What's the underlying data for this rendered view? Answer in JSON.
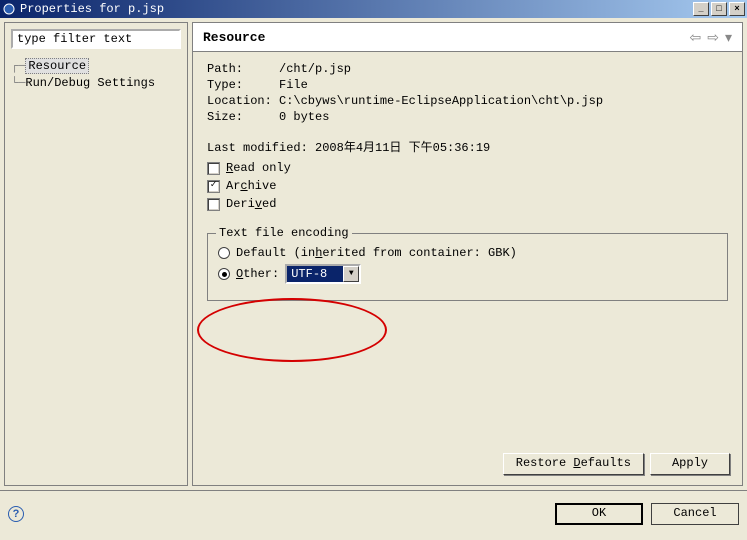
{
  "window": {
    "title": "Properties for p.jsp",
    "minimize": "_",
    "maximize": "□",
    "close": "×"
  },
  "filter": {
    "placeholder": "type filter text"
  },
  "tree": {
    "resource": "Resource",
    "runDebug": "Run/Debug Settings"
  },
  "header": {
    "title": "Resource"
  },
  "info": {
    "pathKey": "Path:",
    "pathVal": "/cht/p.jsp",
    "typeKey": "Type:",
    "typeVal": "File",
    "locKey": "Location:",
    "locVal": "C:\\cbyws\\runtime-EclipseApplication\\cht\\p.jsp",
    "sizeKey": "Size:",
    "sizeVal": "0 bytes",
    "lastModified": "Last modified: 2008年4月11日 下午05:36:19"
  },
  "flags": {
    "readOnlyLabel": "Read only",
    "readOnly": false,
    "archiveLabel": "Archive",
    "archive": true,
    "derivedLabel": "Derived",
    "derived": false
  },
  "encoding": {
    "legend": "Text file encoding",
    "defaultLabel": "Default (inherited from container: GBK)",
    "otherLabel": "Other:",
    "selected": "other",
    "otherValue": "UTF-8"
  },
  "buttons": {
    "restore": "Restore Defaults",
    "apply": "Apply",
    "ok": "OK",
    "cancel": "Cancel"
  }
}
